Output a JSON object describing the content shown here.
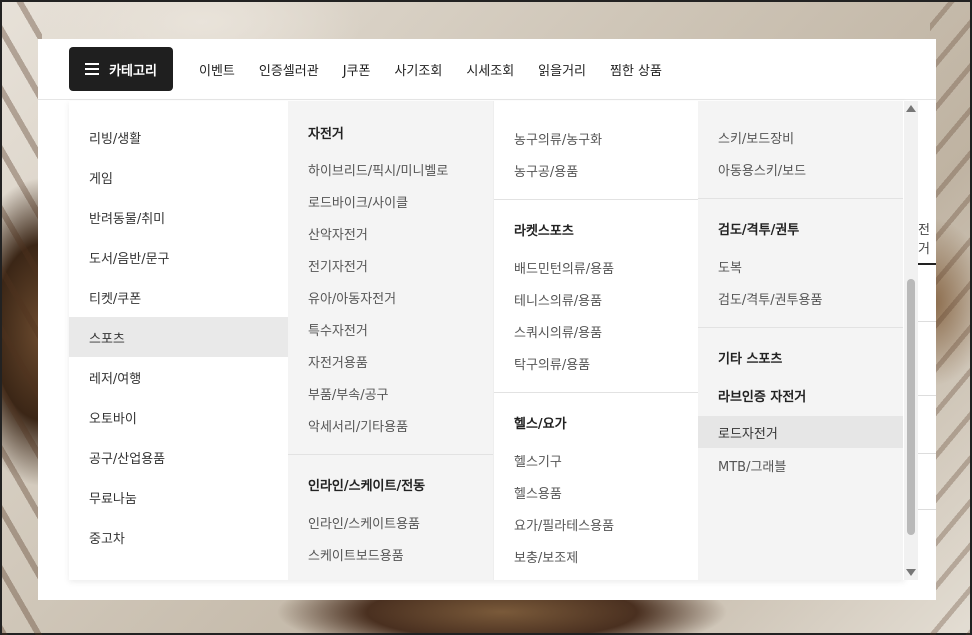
{
  "topbar": {
    "category_button": "카테고리",
    "nav": [
      "이벤트",
      "인증셀러관",
      "J쿠폰",
      "사기조회",
      "시세조회",
      "읽을거리",
      "찜한 상품"
    ]
  },
  "categories": {
    "items": [
      "리빙/생활",
      "게임",
      "반려동물/취미",
      "도서/음반/문구",
      "티켓/쿠폰",
      "스포츠",
      "레저/여행",
      "오토바이",
      "공구/산업용품",
      "무료나눔",
      "중고차"
    ],
    "active_index": 5
  },
  "col2": {
    "groups": [
      {
        "title": "자전거",
        "items": [
          "하이브리드/픽시/미니벨로",
          "로드바이크/사이클",
          "산악자전거",
          "전기자전거",
          "유아/아동자전거",
          "특수자전거",
          "자전거용품",
          "부품/부속/공구",
          "악세서리/기타용품"
        ]
      },
      {
        "title": "인라인/스케이트/전동",
        "items": [
          "인라인/스케이트용품",
          "스케이트보드용품"
        ]
      }
    ]
  },
  "col3": {
    "groups": [
      {
        "title": "",
        "items": [
          "농구의류/농구화",
          "농구공/용품"
        ]
      },
      {
        "title": "라켓스포츠",
        "items": [
          "배드민턴의류/용품",
          "테니스의류/용품",
          "스쿼시의류/용품",
          "탁구의류/용품"
        ]
      },
      {
        "title": "헬스/요가",
        "items": [
          "헬스기구",
          "헬스용품",
          "요가/필라테스용품",
          "보충/보조제"
        ]
      }
    ]
  },
  "col4": {
    "groups": [
      {
        "title": "",
        "items": [
          "스키/보드장비",
          "아동용스키/보드"
        ]
      },
      {
        "title": "검도/격투/권투",
        "items": [
          "도복",
          "검도/격투/권투용품"
        ]
      },
      {
        "title": "기타 스포츠",
        "items": []
      },
      {
        "title": "라브인증 자전거",
        "items": [
          "로드자전거",
          "MTB/그래블"
        ]
      }
    ],
    "highlighted": "로드자전거"
  },
  "side_peek": "전거"
}
